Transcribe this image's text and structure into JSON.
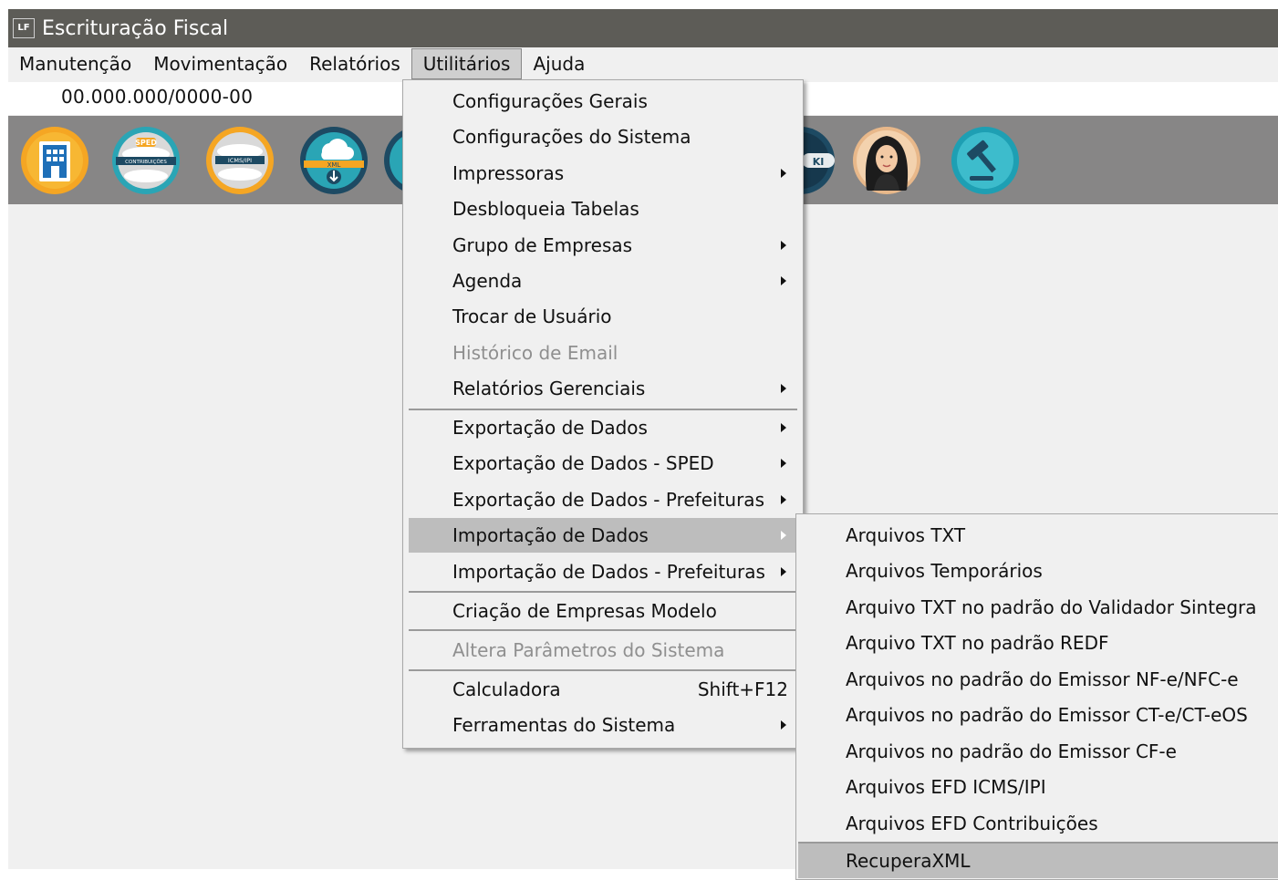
{
  "window": {
    "title": "Escrituração Fiscal",
    "icon_label": "LF"
  },
  "menubar": [
    "Manutenção",
    "Movimentação",
    "Relatórios",
    "Utilitários",
    "Ajuda"
  ],
  "menubar_active": "Utilitários",
  "company_id": "00.000.000/0000-00",
  "toolbar": {
    "icons": [
      "company-icon",
      "sped-contribuicoes-icon",
      "icms-ipi-icon",
      "xml-download-icon",
      "partial-icon",
      "nfse-icon",
      "avatar-assistant-icon",
      "gavel-icon"
    ],
    "sped_badge": "SPED",
    "sped_sub": "CONTRIBUIÇÕES",
    "icms_label": "ICMS/IPI",
    "xml_label": "XML",
    "partial_label": "KI"
  },
  "utilitarios_menu": {
    "items": [
      {
        "label": "Configurações Gerais"
      },
      {
        "label": "Configurações do Sistema"
      },
      {
        "label": "Impressoras",
        "submenu": true
      },
      {
        "label": "Desbloqueia Tabelas"
      },
      {
        "label": "Grupo de Empresas",
        "submenu": true
      },
      {
        "label": "Agenda",
        "submenu": true
      },
      {
        "label": "Trocar de Usuário"
      },
      {
        "label": "Histórico de Email",
        "disabled": true
      },
      {
        "label": "Relatórios Gerenciais",
        "submenu": true
      },
      {
        "label": "Exportação de Dados",
        "submenu": true
      },
      {
        "label": "Exportação de Dados - SPED",
        "submenu": true
      },
      {
        "label": "Exportação de Dados - Prefeituras",
        "submenu": true
      },
      {
        "label": "Importação de Dados",
        "submenu": true,
        "highlighted": true
      },
      {
        "label": "Importação de Dados - Prefeituras",
        "submenu": true
      },
      {
        "label": "Criação de Empresas Modelo"
      },
      {
        "label": "Altera Parâmetros do Sistema",
        "disabled": true
      },
      {
        "label": "Calculadora",
        "shortcut": "Shift+F12"
      },
      {
        "label": "Ferramentas do Sistema",
        "submenu": true
      }
    ]
  },
  "importacao_submenu": {
    "items": [
      {
        "label": "Arquivos TXT"
      },
      {
        "label": "Arquivos Temporários"
      },
      {
        "label": "Arquivo TXT no padrão do Validador Sintegra"
      },
      {
        "label": "Arquivo TXT no padrão REDF"
      },
      {
        "label": "Arquivos no padrão do Emissor NF-e/NFC-e"
      },
      {
        "label": "Arquivos no padrão do Emissor CT-e/CT-eOS"
      },
      {
        "label": "Arquivos no padrão do Emissor CF-e"
      },
      {
        "label": "Arquivos EFD ICMS/IPI"
      },
      {
        "label": "Arquivos EFD Contribuições"
      },
      {
        "label": "RecuperaXML",
        "highlighted": true
      }
    ]
  },
  "colors": {
    "titlebar": "#5d5c57",
    "toolbar": "#878686",
    "menu_bg": "#f0f0f0",
    "highlight": "#bdbdbd",
    "disabled_text": "#8f8f8f",
    "accent_orange": "#f5a623",
    "accent_teal": "#2aa5b5",
    "dark_navy": "#1d4a63"
  }
}
